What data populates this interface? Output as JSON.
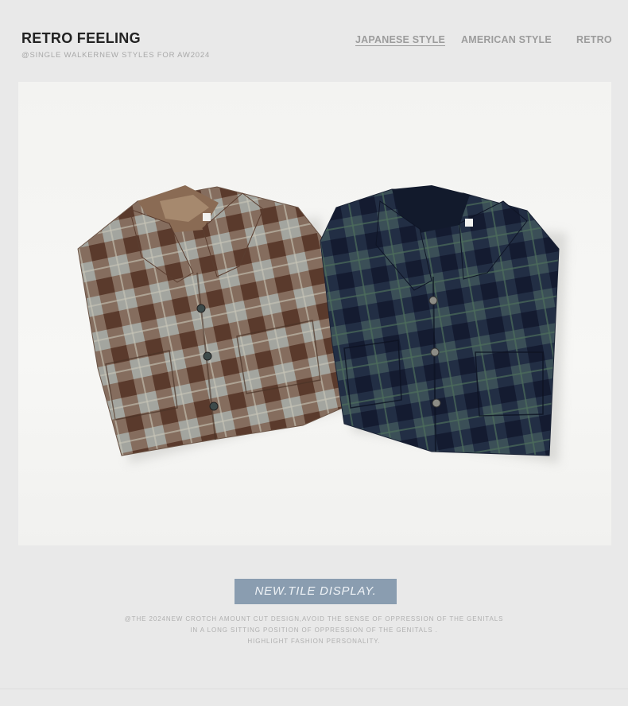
{
  "header": {
    "title": "RETRO FEELING",
    "subtitle": "@SINGLE WALKERNEW STYLES FOR AW2024"
  },
  "nav": {
    "items": [
      {
        "label": "JAPANESE STYLE",
        "active": true
      },
      {
        "label": "AMERICAN STYLE",
        "active": false
      },
      {
        "label": "RETRO",
        "active": false
      }
    ]
  },
  "photo": {
    "subject": "two folded plaid flannel shirts",
    "shirts": [
      {
        "colorway": "brown-grey check",
        "primary": "#6a4a3a",
        "secondary": "#9aa09c"
      },
      {
        "colorway": "navy-green check",
        "primary": "#1f2a40",
        "secondary": "#3e5a55"
      }
    ]
  },
  "badge": {
    "label": "NEW.TILE DISPLAY."
  },
  "caption": {
    "lines": [
      "@THE 2024NEW CROTCH AMOUNT CUT DESIGN,AVOID THE SENSE OF OPPRESSION OF THE GENITALS",
      "IN A LONG SITTING POSITION OF OPPRESSION OF THE GENITALS .",
      "HIGHLIGHT FASHION PERSONALITY."
    ]
  },
  "colors": {
    "page_bg": "#e9e9e9",
    "title": "#222222",
    "muted": "#9c9c9c",
    "badge_bg": "#8a9db0"
  }
}
